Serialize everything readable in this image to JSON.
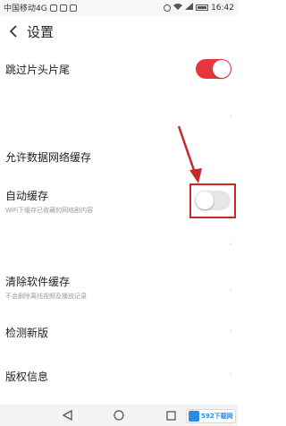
{
  "status_bar": {
    "carrier": "中国移动4G",
    "time": "16:42"
  },
  "header": {
    "title": "设置"
  },
  "settings": {
    "skip_intro": {
      "label": "跳过片头片尾",
      "enabled": true
    },
    "data_cache": {
      "label": "允许数据网络缓存"
    },
    "auto_cache": {
      "label": "自动缓存",
      "sub": "WiFi下缓存已收藏的网络剧内容",
      "enabled": false
    },
    "clear_cache": {
      "label": "清除软件缓存",
      "sub": "不会删除离线视频及播放记录"
    },
    "check_update": {
      "label": "检测新版"
    },
    "copyright": {
      "label": "版权信息"
    }
  },
  "watermark": {
    "text": "592下载网"
  },
  "colors": {
    "toggle_on": "#e8373c",
    "toggle_off": "#e6e6e6",
    "annotation": "#c62828"
  }
}
